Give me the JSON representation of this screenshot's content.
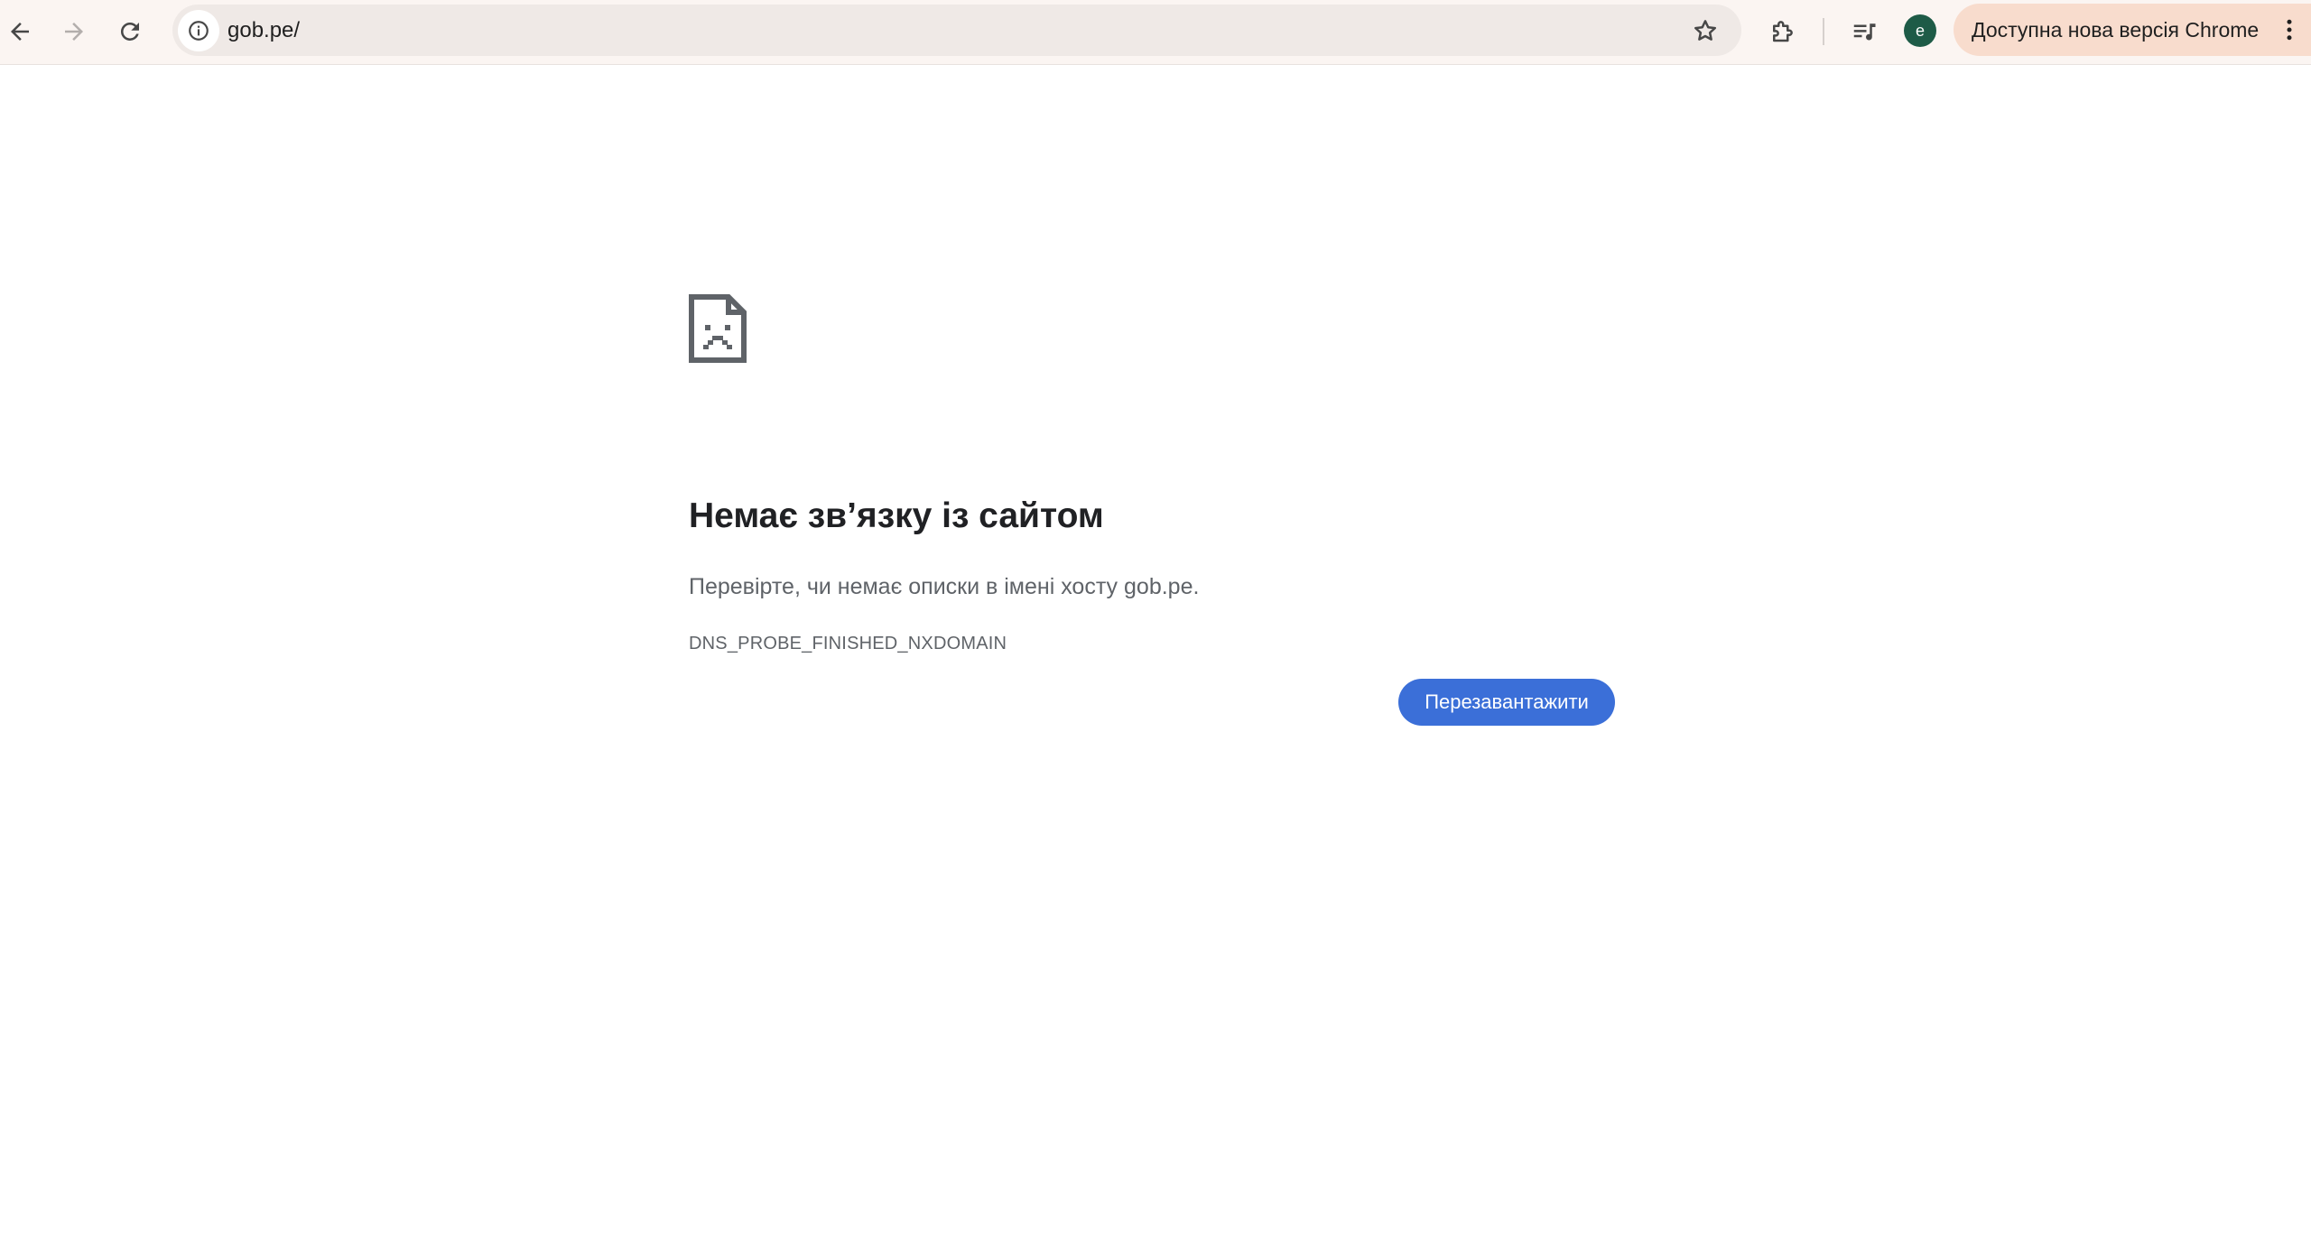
{
  "browser": {
    "url": "gob.pe/",
    "profile_initial": "e",
    "update_chip_label": "Доступна нова версія Chrome",
    "colors": {
      "toolbar_bg": "#fbf5f2",
      "omnibox_bg": "#efe9e6",
      "update_chip_bg": "#f8dccd",
      "avatar_bg": "#1e5b47"
    },
    "icons": [
      "back-arrow-icon",
      "forward-arrow-icon",
      "reload-icon",
      "site-info-icon",
      "bookmark-star-icon",
      "extensions-puzzle-icon",
      "media-controls-icon",
      "more-vert-icon"
    ]
  },
  "error_page": {
    "icon": "sad-page-icon",
    "title": "Немає звʼязку із сайтом",
    "description": "Перевірте, чи немає описки в імені хосту gob.pe.",
    "error_code": "DNS_PROBE_FINISHED_NXDOMAIN",
    "reload_button_label": "Перезавантажити",
    "colors": {
      "title": "#202124",
      "text": "#5f6368",
      "button_bg": "#3b6fd8"
    }
  }
}
